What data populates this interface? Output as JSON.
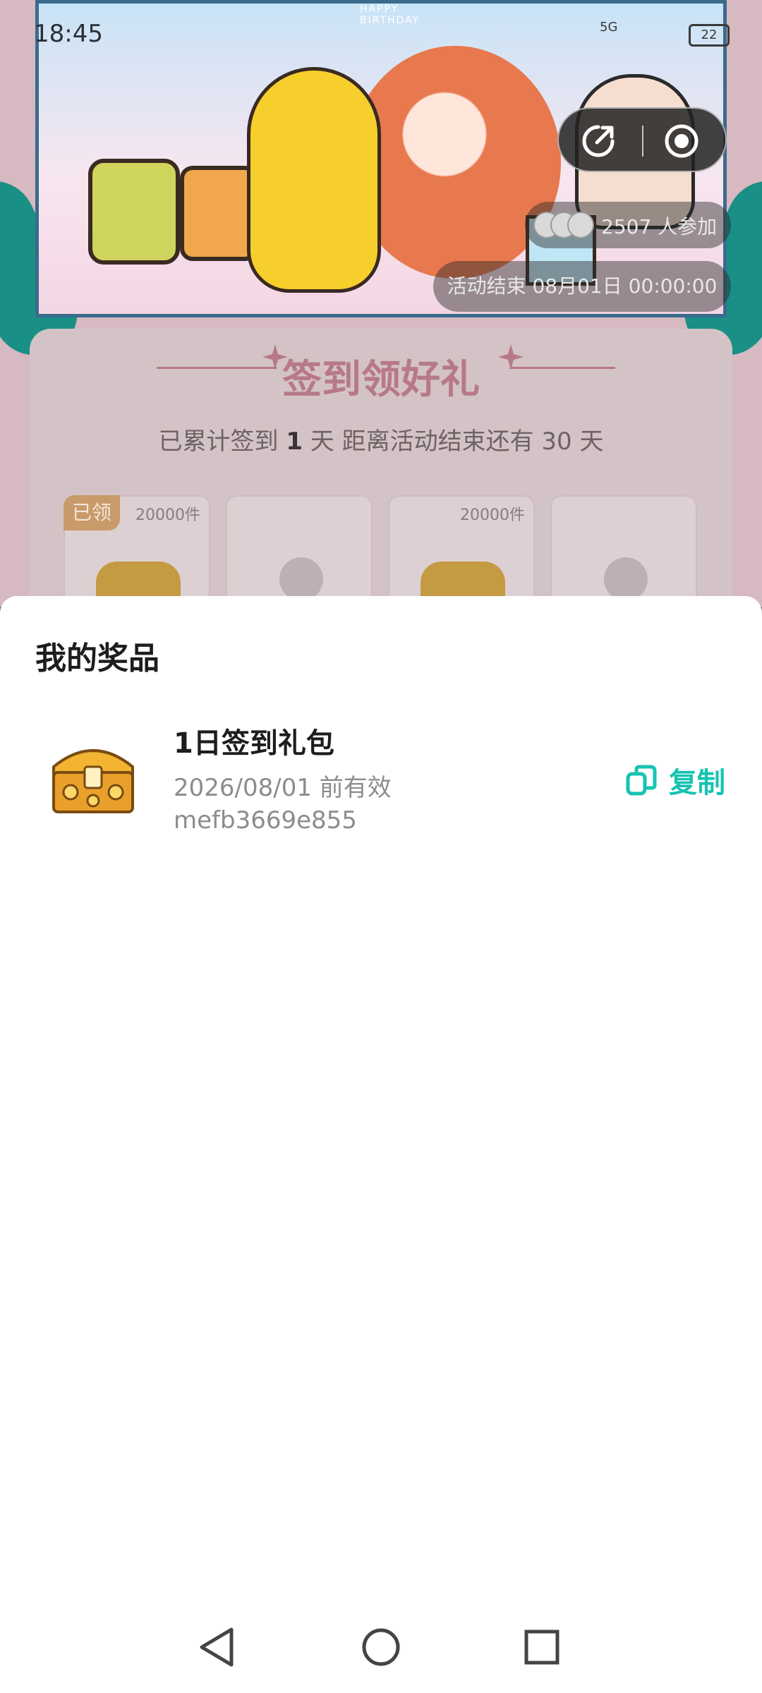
{
  "status_bar": {
    "time": "18:45",
    "battery": "22",
    "network": "5G"
  },
  "banner": {
    "tagline": "HAPPY BIRTHDAY"
  },
  "capsule": {
    "share_icon": "share-icon",
    "record_icon": "record-icon"
  },
  "activity": {
    "participants": "2507 人参加",
    "end_time": "活动结束 08月01日 00:00:00"
  },
  "card": {
    "title": "签到领好礼",
    "sub_prefix": "已累计签到 ",
    "sub_days": "1",
    "sub_suffix": " 天  距离活动结束还有 30 天",
    "slots": [
      {
        "claimed_label": "已领",
        "quantity": "20000件"
      },
      {
        "claimed_label": "",
        "quantity": ""
      },
      {
        "claimed_label": "",
        "quantity": "20000件"
      },
      {
        "claimed_label": "",
        "quantity": ""
      }
    ]
  },
  "sheet": {
    "title": "我的奖品",
    "prizes": [
      {
        "name": "1日签到礼包",
        "expiry": "2026/08/01 前有效",
        "code": "mefb3669e855",
        "copy_label": "复制",
        "icon": "treasure-chest-icon"
      }
    ]
  },
  "nav": {
    "back_icon": "back-triangle-icon",
    "home_icon": "home-circle-icon",
    "recents_icon": "recents-square-icon"
  },
  "colors": {
    "accent": "#17c3b2",
    "sheet_bg": "#ffffff",
    "title_text": "#1d1d1f",
    "secondary_text": "#8c8c8c"
  }
}
